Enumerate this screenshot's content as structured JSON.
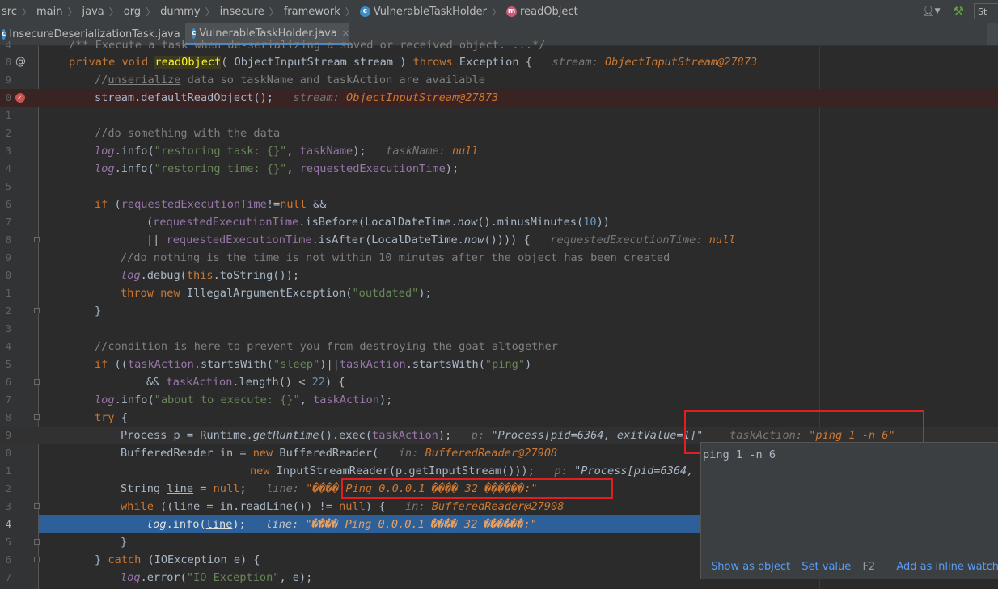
{
  "breadcrumbs": [
    "src",
    "main",
    "java",
    "org",
    "dummy",
    "insecure",
    "framework",
    "VulnerableTaskHolder",
    "readObject"
  ],
  "toolbar": {
    "run_config": "St"
  },
  "tabs": [
    {
      "label": "InsecureDeserializationTask.java",
      "active": false
    },
    {
      "label": "VulnerableTaskHolder.java",
      "active": true
    }
  ],
  "line_numbers": [
    "4",
    "8",
    "9",
    "0",
    "1",
    "2",
    "3",
    "4",
    "5",
    "6",
    "7",
    "8",
    "9",
    "0",
    "1",
    "2",
    "3",
    "4",
    "5",
    "6",
    "7",
    "8",
    "9",
    "0",
    "1",
    "2",
    "3",
    "4",
    "5",
    "6",
    "7"
  ],
  "code": {
    "l0": "/** Execute a task when de-serializing a saved or received object. ...*/",
    "l1": {
      "kw1": "private void ",
      "method": "readObject",
      "rest": "( ObjectInputStream stream ) ",
      "kw2": "throws",
      "rest2": " Exception {",
      "hint_k": "stream: ",
      "hint_v": "ObjectInputStream@27873"
    },
    "l2": {
      "a": "//",
      "b": "unserialize",
      "c": " data so taskName and taskAction are available"
    },
    "l3": {
      "code": "stream.defaultReadObject();",
      "hint_k": "stream: ",
      "hint_v": "ObjectInputStream@27873"
    },
    "l5": "//do something with the data",
    "l6": {
      "log": "log",
      "a": ".info(",
      "s": "\"restoring task: {}\"",
      "b": ", ",
      "f": "taskName",
      "c": ");",
      "hint_k": "taskName: ",
      "hint_v": "null"
    },
    "l7": {
      "log": "log",
      "a": ".info(",
      "s": "\"restoring time: {}\"",
      "b": ", ",
      "f": "requestedExecutionTime",
      "c": ");"
    },
    "l9": {
      "kw": "if",
      "a": " (",
      "f": "requestedExecutionTime",
      "b": "!=",
      "kw2": "null",
      "c": " &&"
    },
    "l10": {
      "a": "(",
      "f": "requestedExecutionTime",
      "b": ".isBefore(LocalDateTime.",
      "now": "now",
      "c": "().minusMinutes(",
      "n": "10",
      "d": "))"
    },
    "l11": {
      "a": "|| ",
      "f": "requestedExecutionTime",
      "b": ".isAfter(LocalDateTime.",
      "now": "now",
      "c": "()))) {",
      "hint_k": "requestedExecutionTime: ",
      "hint_v": "null"
    },
    "l12": "//do nothing is the time is not within 10 minutes after the object has been created",
    "l13": {
      "log": "log",
      "a": ".debug(",
      "kw": "this",
      "b": ".toString());"
    },
    "l14": {
      "kw": "throw new",
      "a": " IllegalArgumentException(",
      "s": "\"outdated\"",
      "b": ");"
    },
    "l15": "}",
    "l17": "//condition is here to prevent you from destroying the goat altogether",
    "l18": {
      "kw": "if",
      "a": " ((",
      "f": "taskAction",
      "b": ".startsWith(",
      "s": "\"sleep\"",
      "c": ")||",
      "f2": "taskAction",
      "d": ".startsWith(",
      "s2": "\"ping\"",
      "e": ")"
    },
    "l19": {
      "a": "&& ",
      "f": "taskAction",
      "b": ".length() < ",
      "n": "22",
      "c": ") {"
    },
    "l20": {
      "log": "log",
      "a": ".info(",
      "s": "\"about to execute: {}\"",
      "b": ", ",
      "f": "taskAction",
      "c": ");"
    },
    "l21": {
      "kw": "try",
      "a": " {"
    },
    "l22": {
      "a": "Process p = Runtime.",
      "m": "getRuntime",
      "b": "().exec(",
      "f": "taskAction",
      "c": ");",
      "hint1_k": "p: ",
      "hint1_v": "\"Process[pid=6364, exitValue=1]\"",
      "hint2_k": "taskAction: ",
      "hint2_v": "\"ping 1 -n 6\""
    },
    "l23": {
      "a": "BufferedReader in = ",
      "kw": "new",
      "b": " BufferedReader(",
      "hint_k": "in: ",
      "hint_v": "BufferedReader@27908"
    },
    "l24": {
      "kw": "new",
      "a": " InputStreamReader(p.getInputStream()));",
      "hint_k": "p: ",
      "hint_v": "\"Process[pid=6364, ex"
    },
    "l25": {
      "a": "String ",
      "u": "line",
      "b": " = ",
      "kw": "null",
      "c": ";",
      "hint_k": "line: ",
      "hint_v": "\"���� Ping 0.0.0.1 ���� 32 �ֽ�����:\""
    },
    "l26": {
      "kw": "while",
      "a": " ((",
      "u": "line",
      "b": " = in.readLine()) != ",
      "kw2": "null",
      "c": ") {",
      "hint_k": "in: ",
      "hint_v": "BufferedReader@27908"
    },
    "l27": {
      "log": "log",
      "a": ".info(",
      "u": "line",
      "b": ");",
      "hint_k": "line: ",
      "hint_v": "\"���� Ping 0.0.0.1 ���� 32 �ֽ�����:\""
    },
    "l28": "}",
    "l29": {
      "a": "} ",
      "kw": "catch",
      "b": " (IOException e) {"
    },
    "l30": {
      "log": "log",
      "a": ".error(",
      "s": "\"IO Exception\"",
      "b": ", e);"
    }
  },
  "popup": {
    "value": "ping 1 -n 6",
    "show_as_object": "Show as object",
    "set_value": "Set value",
    "set_value_key": "F2",
    "add_inline_watch": "Add as inline watch"
  }
}
